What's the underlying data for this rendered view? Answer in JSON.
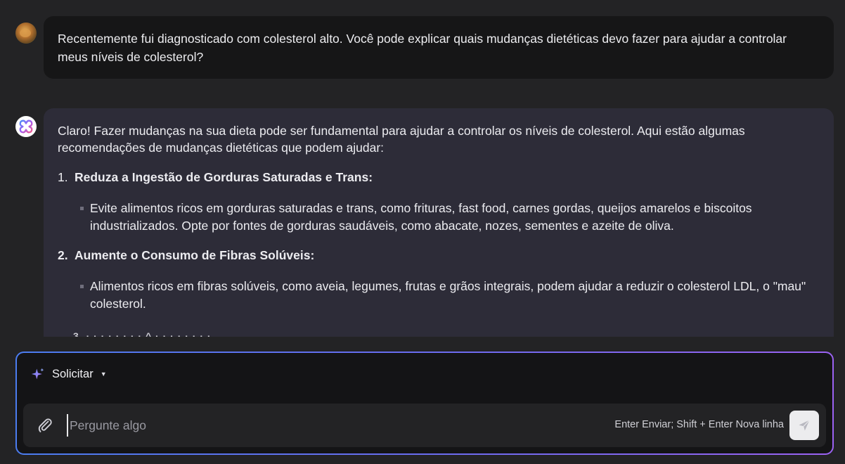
{
  "messages": {
    "user": {
      "text": "Recentemente fui diagnosticado com colesterol alto. Você pode explicar quais mudanças dietéticas devo fazer para ajudar a controlar meus níveis de colesterol?"
    },
    "assistant": {
      "intro": "Claro! Fazer mudanças na sua dieta pode ser fundamental para ajudar a controlar os níveis de colesterol. Aqui estão algumas recomendações de mudanças dietéticas que podem ajudar:",
      "items": [
        {
          "number": "1.",
          "title": "Reduza a Ingestão de Gorduras Saturadas e Trans:",
          "bullet": "Evite alimentos ricos em gorduras saturadas e trans, como frituras, fast food, carnes gordas, queijos amarelos e biscoitos industrializados. Opte por fontes de gorduras saudáveis, como abacate, nozes, sementes e azeite de oliva."
        },
        {
          "number": "2.",
          "title": "Aumente o Consumo de Fibras Solúveis:",
          "bullet": "Alimentos ricos em fibras solúveis, como aveia, legumes, frutas e grãos integrais, podem ajudar a reduzir o colesterol LDL, o \"mau\" colesterol."
        }
      ],
      "truncated_line": "3.  · · · · · · · ·  ^  · · · · · · · ·"
    }
  },
  "composer": {
    "mode_label": "Solicitar",
    "placeholder": "Pergunte algo",
    "hint": "Enter Enviar; Shift + Enter Nova linha"
  },
  "icons": {
    "user_avatar": "user-avatar",
    "assistant_avatar": "assistant-logo-icon",
    "mode": "sparkle-icon",
    "mode_caret": "caret-down-icon",
    "attach": "paperclip-icon",
    "send": "send-icon"
  },
  "colors": {
    "background": "#232325",
    "user_bubble": "#161617",
    "assistant_bubble": "#2d2c38",
    "composer_border_start": "#4b7cf0",
    "composer_border_end": "#9b62f2"
  }
}
